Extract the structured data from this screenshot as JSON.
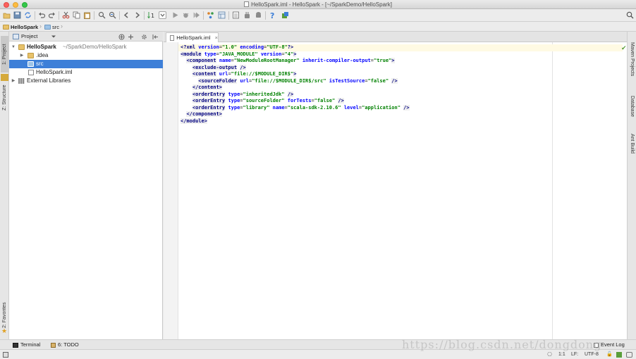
{
  "window": {
    "title": "HelloSpark.iml - HelloSpark - [~/SparkDemo/HelloSpark]"
  },
  "toolbar": {
    "icons": [
      "open-folder-icon",
      "save-icon",
      "sync-icon",
      "undo-icon",
      "redo-icon",
      "cut-icon",
      "copy-icon",
      "paste-icon",
      "find-icon",
      "replace-icon",
      "back-icon",
      "forward-icon",
      "make-icon",
      "run-config-dropdown",
      "run-icon",
      "debug-icon",
      "coverage-icon",
      "stop-icon",
      "vcs-icon",
      "project-structure-icon",
      "sdk-icon",
      "plugin-icon",
      "android-icon",
      "help-icon",
      "tasks-icon",
      "search-everywhere-icon"
    ]
  },
  "navbar": {
    "crumbs": [
      "HelloSpark",
      "src"
    ]
  },
  "left_stripe": {
    "project_tab": "1: Project",
    "structure_tab": "Z: Structure",
    "favorites_tab": "2: Favorites"
  },
  "right_stripe": {
    "maven_tab": "Maven Projects",
    "database_tab": "Database",
    "ant_tab": "Ant Build"
  },
  "project_panel": {
    "title": "Project",
    "tree": [
      {
        "label": "HelloSpark",
        "suffix": "~/SparkDemo/HelloSpark",
        "level": 0,
        "expanded": true,
        "kind": "module"
      },
      {
        "label": ".idea",
        "level": 1,
        "expanded": false,
        "kind": "folder"
      },
      {
        "label": "src",
        "level": 1,
        "kind": "source-folder",
        "selected": true
      },
      {
        "label": "HelloSpark.iml",
        "level": 1,
        "kind": "file"
      },
      {
        "label": "External Libraries",
        "level": 0,
        "expanded": false,
        "kind": "library"
      }
    ]
  },
  "editor": {
    "tab_label": "HelloSpark.iml",
    "tab_close": "×",
    "lines": [
      [
        [
          "pn",
          "<?xml "
        ],
        [
          "at",
          "version"
        ],
        [
          "",
          "="
        ],
        [
          "vl",
          "\"1.0\""
        ],
        [
          "",
          ""
        ],
        [
          "at",
          " encoding"
        ],
        [
          "",
          "="
        ],
        [
          "vl",
          "\"UTF-8\""
        ],
        [
          "pn",
          "?>"
        ]
      ],
      [
        [
          "tg",
          "<module"
        ],
        [
          "",
          " "
        ],
        [
          "at",
          "type"
        ],
        [
          "",
          "="
        ],
        [
          "vl",
          "\"JAVA_MODULE\""
        ],
        [
          "",
          " "
        ],
        [
          "at",
          "version"
        ],
        [
          "",
          "="
        ],
        [
          "vl",
          "\"4\""
        ],
        [
          "tg",
          ">"
        ]
      ],
      [
        [
          "",
          "  "
        ],
        [
          "tg",
          "<component"
        ],
        [
          "",
          " "
        ],
        [
          "at",
          "name"
        ],
        [
          "",
          "="
        ],
        [
          "vl",
          "\"NewModuleRootManager\""
        ],
        [
          "",
          " "
        ],
        [
          "at",
          "inherit-compiler-output"
        ],
        [
          "",
          "="
        ],
        [
          "vl",
          "\"true\""
        ],
        [
          "tg",
          ">"
        ]
      ],
      [
        [
          "",
          "    "
        ],
        [
          "tg",
          "<exclude-output"
        ],
        [
          "",
          " "
        ],
        [
          "tg",
          "/>"
        ]
      ],
      [
        [
          "",
          "    "
        ],
        [
          "tg",
          "<content"
        ],
        [
          "",
          " "
        ],
        [
          "at",
          "url"
        ],
        [
          "",
          "="
        ],
        [
          "vl",
          "\"file://$MODULE_DIR$\""
        ],
        [
          "tg",
          ">"
        ]
      ],
      [
        [
          "",
          "      "
        ],
        [
          "tg",
          "<sourceFolder"
        ],
        [
          "",
          " "
        ],
        [
          "at",
          "url"
        ],
        [
          "",
          "="
        ],
        [
          "vl",
          "\"file://$MODULE_DIR$/src\""
        ],
        [
          "",
          " "
        ],
        [
          "at",
          "isTestSource"
        ],
        [
          "",
          "="
        ],
        [
          "vl",
          "\"false\""
        ],
        [
          "",
          " "
        ],
        [
          "tg",
          "/>"
        ]
      ],
      [
        [
          "",
          "    "
        ],
        [
          "tg",
          "</content>"
        ]
      ],
      [
        [
          "",
          "    "
        ],
        [
          "tg",
          "<orderEntry"
        ],
        [
          "",
          " "
        ],
        [
          "at",
          "type"
        ],
        [
          "",
          "="
        ],
        [
          "vl",
          "\"inheritedJdk\""
        ],
        [
          "",
          " "
        ],
        [
          "tg",
          "/>"
        ]
      ],
      [
        [
          "",
          "    "
        ],
        [
          "tg",
          "<orderEntry"
        ],
        [
          "",
          " "
        ],
        [
          "at",
          "type"
        ],
        [
          "",
          "="
        ],
        [
          "vl",
          "\"sourceFolder\""
        ],
        [
          "",
          " "
        ],
        [
          "at",
          "forTests"
        ],
        [
          "",
          "="
        ],
        [
          "vl",
          "\"false\""
        ],
        [
          "",
          " "
        ],
        [
          "tg",
          "/>"
        ]
      ],
      [
        [
          "",
          "    "
        ],
        [
          "tg",
          "<orderEntry"
        ],
        [
          "",
          " "
        ],
        [
          "at",
          "type"
        ],
        [
          "",
          "="
        ],
        [
          "vl",
          "\"library\""
        ],
        [
          "",
          " "
        ],
        [
          "at",
          "name"
        ],
        [
          "",
          "="
        ],
        [
          "vl",
          "\"scala-sdk-2.10.6\""
        ],
        [
          "",
          " "
        ],
        [
          "at",
          "level"
        ],
        [
          "",
          "="
        ],
        [
          "vl",
          "\"application\""
        ],
        [
          "",
          " "
        ],
        [
          "tg",
          "/>"
        ]
      ],
      [
        [
          "",
          "  "
        ],
        [
          "tg",
          "</component>"
        ]
      ],
      [
        [
          "tg",
          "</module>"
        ]
      ]
    ]
  },
  "bottom_tools": {
    "terminal": "Terminal",
    "todo": "6: TODO",
    "event_log": "Event Log"
  },
  "statusbar": {
    "position": "1:1",
    "line_separator": "LF:",
    "encoding": "UTF-8"
  },
  "watermark": "https://blog.csdn.net/dongdong"
}
